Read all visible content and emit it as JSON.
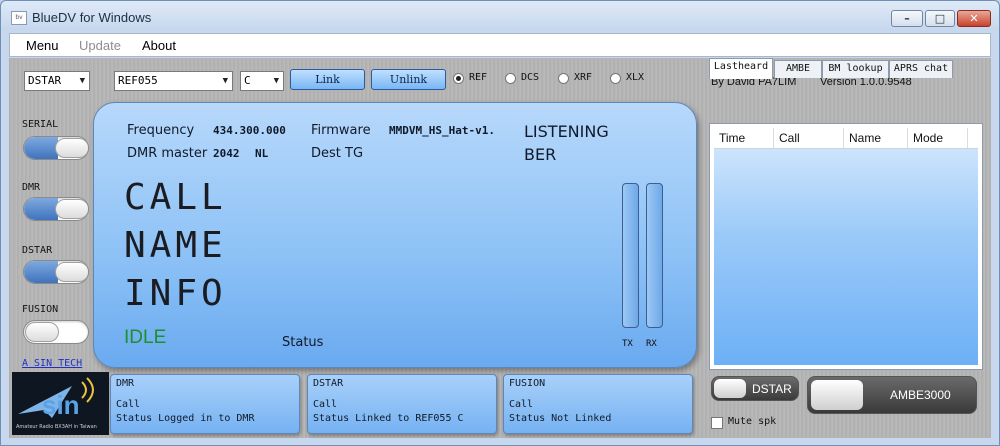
{
  "window": {
    "title": "BlueDV for Windows",
    "icon_text": "bv"
  },
  "menu": {
    "items": [
      "Menu",
      "Update",
      "About"
    ]
  },
  "toolbar": {
    "mode_select": "DSTAR",
    "reflector_select": "REF055",
    "module_select": "C",
    "link_label": "Link",
    "unlink_label": "Unlink",
    "radios": [
      {
        "label": "REF",
        "selected": true
      },
      {
        "label": "DCS",
        "selected": false
      },
      {
        "label": "XRF",
        "selected": false
      },
      {
        "label": "XLX",
        "selected": false
      }
    ],
    "author": "By David PA7LIM",
    "version": "Version 1.0.0.9548"
  },
  "sidebar": {
    "toggles": [
      {
        "label": "SERIAL",
        "on": true
      },
      {
        "label": "DMR",
        "on": true
      },
      {
        "label": "DSTAR",
        "on": true
      },
      {
        "label": "FUSION",
        "on": false
      }
    ],
    "link": "A SIN TECH"
  },
  "display": {
    "frequency_label": "Frequency",
    "frequency_value": "434.300.000",
    "firmware_label": "Firmware",
    "firmware_value": "MMDVM_HS_Hat-v1.",
    "listening": "LISTENING",
    "dmr_master_label": "DMR master",
    "dmr_master_value": "2042",
    "dmr_master_country": "NL",
    "dest_tg_label": "Dest TG",
    "ber_label": "BER",
    "call": "CALL",
    "name": "NAME",
    "info": "INFO",
    "idle": "IDLE",
    "status_label": "Status",
    "tx_label": "TX",
    "rx_label": "RX"
  },
  "tabs": [
    "Lastheard",
    "AMBE",
    "BM lookup",
    "APRS chat"
  ],
  "lastheard": {
    "columns": [
      "Time",
      "Call",
      "Name",
      "Mode"
    ]
  },
  "logo": {
    "text": "sin",
    "caption": "Amateur Radio BX3AH in Taiwan"
  },
  "status_cards": [
    {
      "title": "DMR",
      "call": "Call",
      "status": "Status Logged in to DMR"
    },
    {
      "title": "DSTAR",
      "call": "Call",
      "status": "Status Linked to REF055 C"
    },
    {
      "title": "FUSION",
      "call": "Call",
      "status": "Status Not Linked"
    }
  ],
  "controls": {
    "dstar_toggle": "DSTAR",
    "ambe_toggle": "AMBE3000",
    "mute_label": "Mute spk"
  },
  "colors": {
    "idle": "#1f8f2a",
    "toggle_on": "#3f73bd",
    "link": "#1a32c8"
  }
}
